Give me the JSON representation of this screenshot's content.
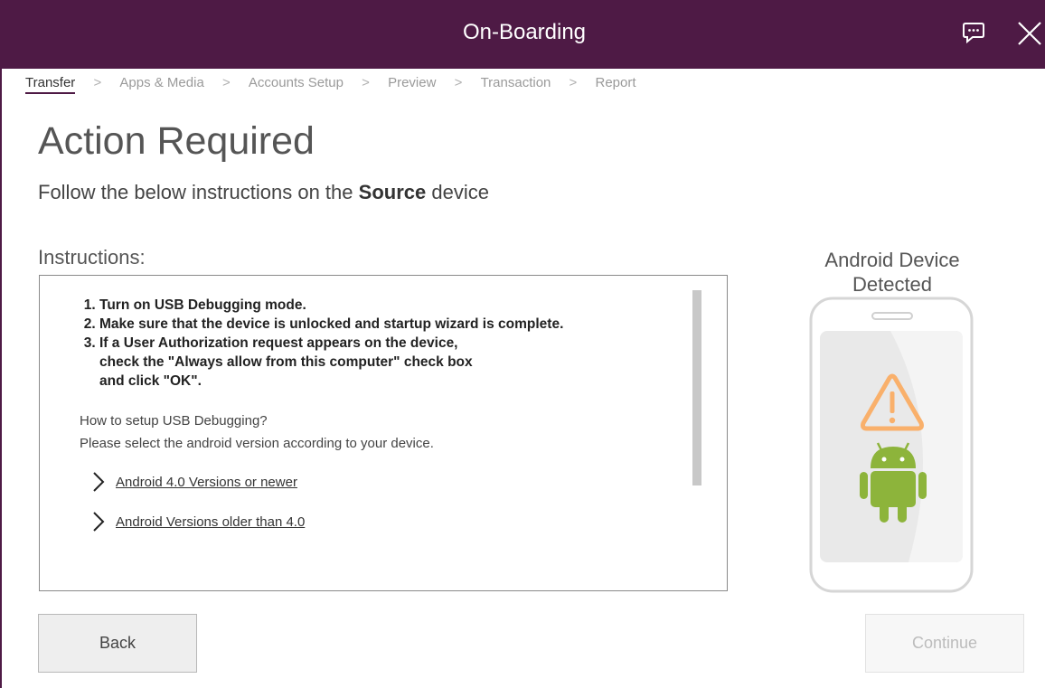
{
  "window": {
    "title": "On-Boarding",
    "icons": {
      "chat": "chat-bubble-icon",
      "close": "close-icon"
    }
  },
  "breadcrumb": {
    "items": [
      {
        "label": "Transfer",
        "active": true
      },
      {
        "label": "Apps & Media",
        "active": false
      },
      {
        "label": "Accounts Setup",
        "active": false
      },
      {
        "label": "Preview",
        "active": false
      },
      {
        "label": "Transaction",
        "active": false
      },
      {
        "label": "Report",
        "active": false
      }
    ],
    "separator": ">"
  },
  "page": {
    "heading": "Action Required",
    "subtitle_prefix": "Follow the below instructions on the ",
    "subtitle_bold": "Source",
    "subtitle_suffix": " device"
  },
  "instructions": {
    "label": "Instructions:",
    "steps": [
      "Turn on USB Debugging mode.",
      "Make sure that the device is unlocked and startup wizard is complete.",
      "If a User Authorization request appears on the device,",
      "check the \"Always allow from this computer\" check box",
      "and click \"OK\"."
    ],
    "help_line1": "How to setup USB Debugging?",
    "help_line2": "Please select the android version according to your device.",
    "links": [
      "Android 4.0 Versions or newer",
      "Android Versions older than 4.0"
    ]
  },
  "device": {
    "label_line1": "Android Device",
    "label_line2": "Detected",
    "icons": [
      "warning-icon",
      "android-icon"
    ],
    "colors": {
      "warning": "#f9b06b",
      "android": "#8db43b",
      "phone_outline": "#d6d6d6"
    }
  },
  "buttons": {
    "back": "Back",
    "continue": "Continue",
    "continue_enabled": false
  },
  "colors": {
    "titlebar": "#4e1a45",
    "title_text": "#ffffff"
  }
}
